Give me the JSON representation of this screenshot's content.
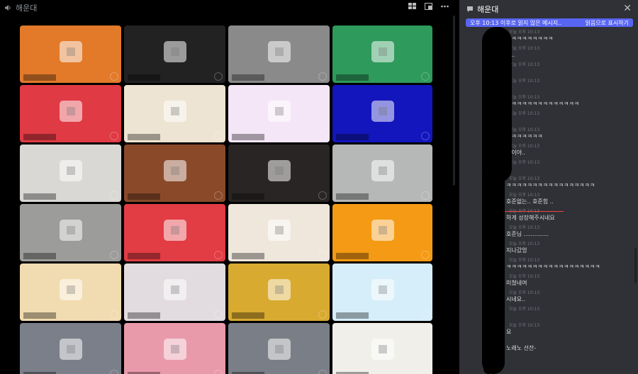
{
  "video": {
    "channel_name": "해운대",
    "tiles": [
      {
        "color": "#e27a2a"
      },
      {
        "color": "#222222"
      },
      {
        "color": "#8a8a8a"
      },
      {
        "color": "#2e9a5b"
      },
      {
        "color": "#e03a44"
      },
      {
        "color": "#eee4d3"
      },
      {
        "color": "#f5e6f7"
      },
      {
        "color": "#1316bd"
      },
      {
        "color": "#d9d8d4"
      },
      {
        "color": "#8a4a2a"
      },
      {
        "color": "#2a2525"
      },
      {
        "color": "#b6b8b8"
      },
      {
        "color": "#9c9c9a"
      },
      {
        "color": "#e23c44"
      },
      {
        "color": "#efe7dc"
      },
      {
        "color": "#f59a14"
      },
      {
        "color": "#f1dbb0"
      },
      {
        "color": "#e2dce0"
      },
      {
        "color": "#d9aa30"
      },
      {
        "color": "#d6eef9"
      },
      {
        "color": "#7a7f89"
      },
      {
        "color": "#e99aaa"
      },
      {
        "color": "#7a7e86"
      },
      {
        "color": "#f0efe9"
      }
    ]
  },
  "chat": {
    "title": "해운대",
    "unread_label": "오후 10:13 이후로 읽지 않은 메시지..",
    "mark_read_label": "읽음으로 표시하기",
    "messages": [
      {
        "time": "오늘 오후 10:13",
        "text": "ㅋㅋㅋㅋㅋㅋㅋㅋㅋ"
      },
      {
        "time": "오늘 오후 10:13",
        "text": "다.."
      },
      {
        "time": "오늘 오후 10:13",
        "text": ""
      },
      {
        "time": "오늘 오후 10:13",
        "text": ""
      },
      {
        "time": "오늘 오후 10:13",
        "text": "ㅋㅋㅋㅋㅋㅋㅋㅋㅋㅋㅋㅋㅋㅋ"
      },
      {
        "time": "오늘 오후 10:13",
        "text": ""
      },
      {
        "time": "오늘 오후 10:13",
        "text": "ㅋㅋㅋㅋㅋㅋㅋ"
      },
      {
        "time": "오늘 오후 10:13",
        "text": "상이야.."
      },
      {
        "time": "오늘 오후 10:13",
        "text": ""
      },
      {
        "time": "오늘 오후 10:13",
        "text": "ㅋㅋㅋㅋㅋㅋㅋㅋㅋㅋㅋㅋㅋㅋㅋㅋㅋ"
      },
      {
        "time": "오늘 오후 10:13",
        "text": "호준없는.. 호준힘 .."
      },
      {
        "time": "오늘 오후 10:13",
        "text": "하게 성장해주시네요"
      },
      {
        "time": "오늘 오후 10:13",
        "text": "호준님 .............."
      },
      {
        "time": "오늘 오후 10:13",
        "text": "지나갔엉"
      },
      {
        "time": "오늘 오후 10:13",
        "text": "ㅋㅋㅋㅋㅋㅋㅋㅋㅋㅋㅋㅋㅋㅋㅋㅋㅋㅋ"
      },
      {
        "time": "오늘 오후 10:13",
        "text": "미쳤네여"
      },
      {
        "time": "오늘 오후 10:13",
        "text": "시네요.."
      },
      {
        "time": "오늘 오후 10:13",
        "text": ""
      },
      {
        "time": "오늘 오후 10:13",
        "text": "요"
      },
      {
        "time": "",
        "text": "노래노 선잔-"
      }
    ]
  }
}
